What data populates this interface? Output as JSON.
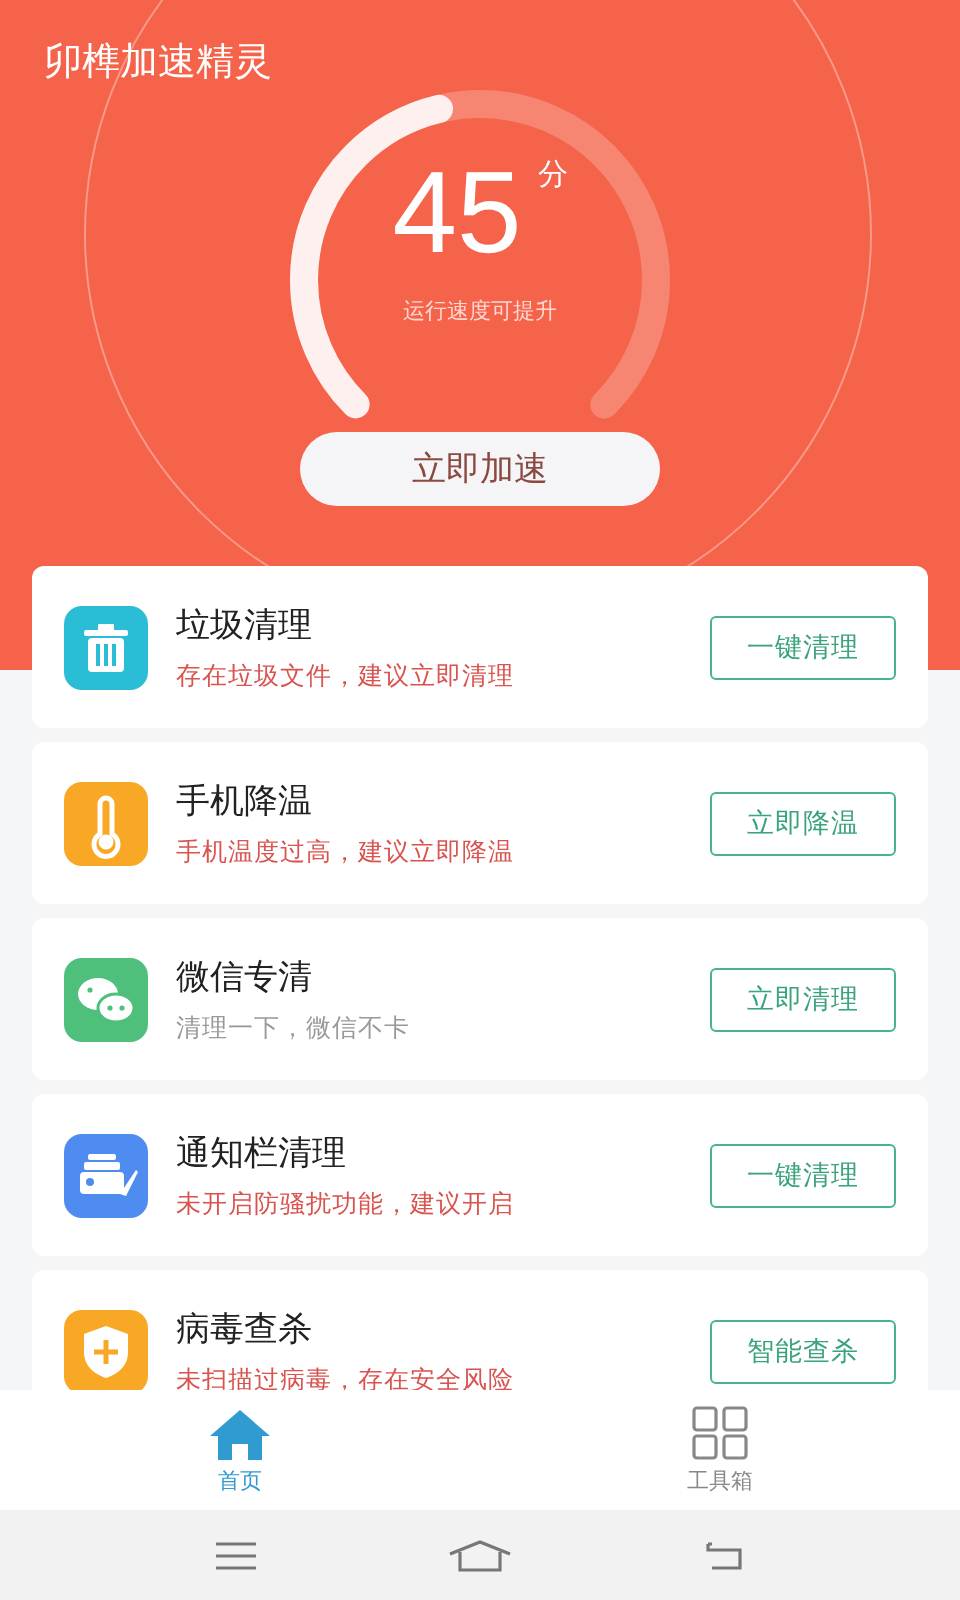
{
  "app_title": "卯榫加速精灵",
  "score": {
    "value": "45",
    "unit": "分",
    "level": 0.45,
    "caption": "运行速度可提升"
  },
  "boost_button": "立即加速",
  "items": [
    {
      "kind": "trash",
      "title": "垃圾清理",
      "description": "存在垃圾文件，建议立即清理",
      "warning": true,
      "button": "一键清理"
    },
    {
      "kind": "thermometer",
      "title": "手机降温",
      "description": "手机温度过高，建议立即降温",
      "warning": true,
      "button": "立即降温"
    },
    {
      "kind": "chat",
      "title": "微信专清",
      "description": "清理一下，微信不卡",
      "warning": false,
      "button": "立即清理"
    },
    {
      "kind": "notification",
      "title": "通知栏清理",
      "description": "未开启防骚扰功能，建议开启",
      "warning": true,
      "button": "一键清理"
    },
    {
      "kind": "shield",
      "title": "病毒查杀",
      "description": "未扫描过病毒，存在安全风险",
      "warning": true,
      "button": "智能查杀"
    }
  ],
  "tabs": [
    {
      "kind": "home",
      "label": "首页",
      "selected": true
    },
    {
      "kind": "grid",
      "label": "工具箱",
      "selected": false
    }
  ]
}
